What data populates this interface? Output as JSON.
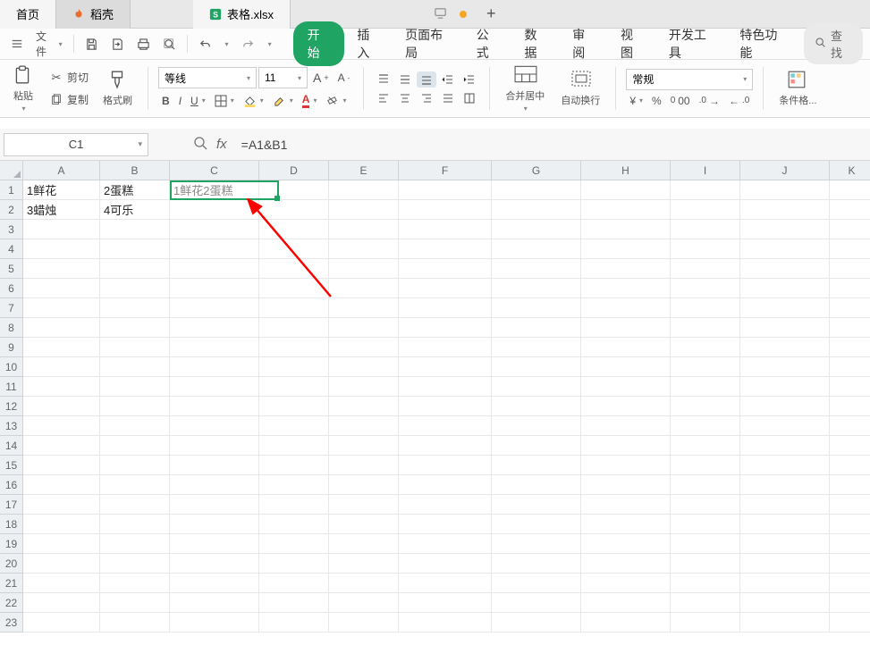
{
  "tabs": {
    "home": "首页",
    "docer_icon_color": "#ee6b2e",
    "docer": "稻壳",
    "sheet_icon_color": "#20a464",
    "file": "表格.xlsx"
  },
  "quick_access": {
    "file_menu": "文件"
  },
  "ribbon_tabs": {
    "start": "开始",
    "insert": "插入",
    "layout": "页面布局",
    "formula": "公式",
    "data": "数据",
    "review": "审阅",
    "view": "视图",
    "dev": "开发工具",
    "special": "特色功能",
    "search": "查找"
  },
  "toolbar": {
    "paste": "粘贴",
    "cut": "剪切",
    "copy": "复制",
    "format_painter": "格式刷",
    "font_name": "等线",
    "font_size": "11",
    "merge": "合并居中",
    "wrap": "自动换行",
    "number_format": "常规",
    "cond_format": "条件格..."
  },
  "name_box": "C1",
  "formula_bar": "=A1&B1",
  "columns": [
    "A",
    "B",
    "C",
    "D",
    "E",
    "F",
    "G",
    "H",
    "I",
    "J",
    "K"
  ],
  "row_count": 23,
  "cells": {
    "A1": "1鲜花",
    "B1": "2蛋糕",
    "C1": "1鲜花2蛋糕",
    "A2": "3蜡烛",
    "B2": "4可乐"
  },
  "selection": {
    "cell": "C1"
  }
}
